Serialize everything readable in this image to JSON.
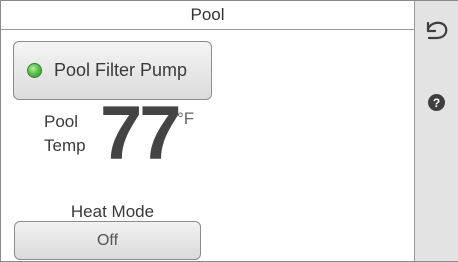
{
  "header": {
    "title": "Pool"
  },
  "sidebar": {
    "back_icon": "back-arrow-icon",
    "help_icon": "help-icon",
    "help_glyph": "?"
  },
  "pump": {
    "label": "Pool Filter Pump",
    "status_color": "#5cc34a",
    "status": "on"
  },
  "temperature": {
    "label_line1": "Pool",
    "label_line2": "Temp",
    "value": "77",
    "unit": "°F"
  },
  "heat_mode": {
    "label": "Heat Mode",
    "value": "Off"
  }
}
